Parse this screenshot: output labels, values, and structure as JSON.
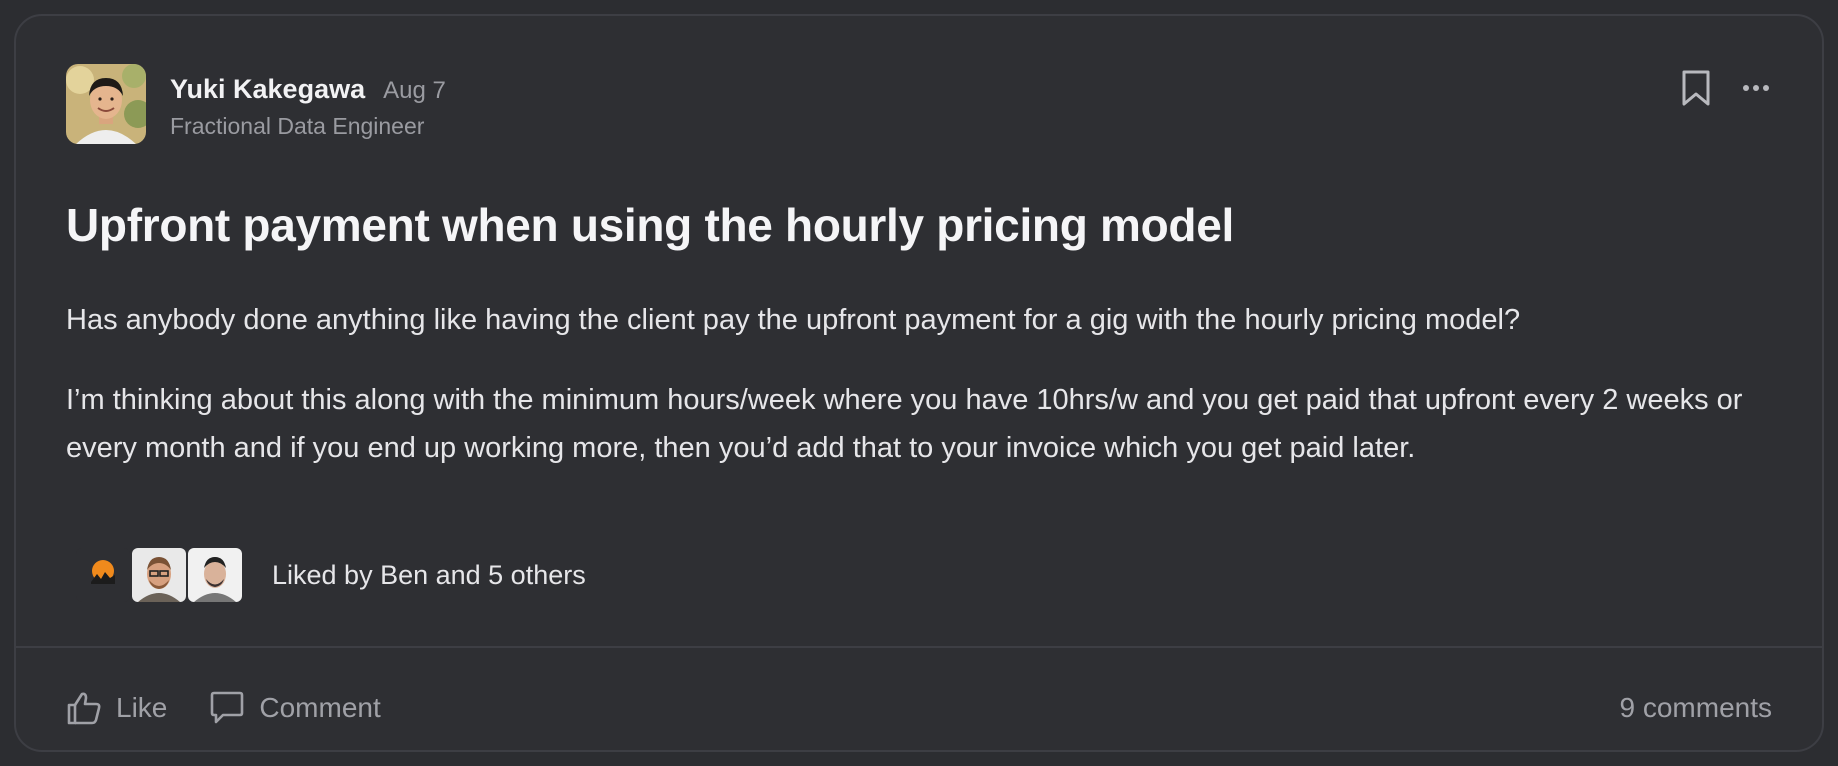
{
  "post": {
    "author": {
      "name": "Yuki Kakegawa",
      "title": "Fractional Data Engineer"
    },
    "date": "Aug 7",
    "title": "Upfront payment when using the hourly pricing model",
    "paragraphs": [
      "Has anybody done anything like having the client pay the upfront payment for a gig with the hourly pricing model?",
      "I’m thinking about this along with the minimum hours/week where you have 10hrs/w and you get paid that upfront every 2 weeks or every month and if you end up working more, then you’d add that to your invoice which you get paid later."
    ],
    "likes": {
      "text": "Liked by Ben and 5 others"
    },
    "actions": {
      "like_label": "Like",
      "comment_label": "Comment",
      "comments_count": "9 comments"
    }
  },
  "icons": {
    "bookmark": "bookmark-icon",
    "more": "more-horizontal-icon",
    "like": "thumbs-up-icon",
    "comment": "comment-icon"
  },
  "colors": {
    "background": "#2e2f33",
    "border": "#3d3e44",
    "muted_text": "#9a9ba1"
  }
}
